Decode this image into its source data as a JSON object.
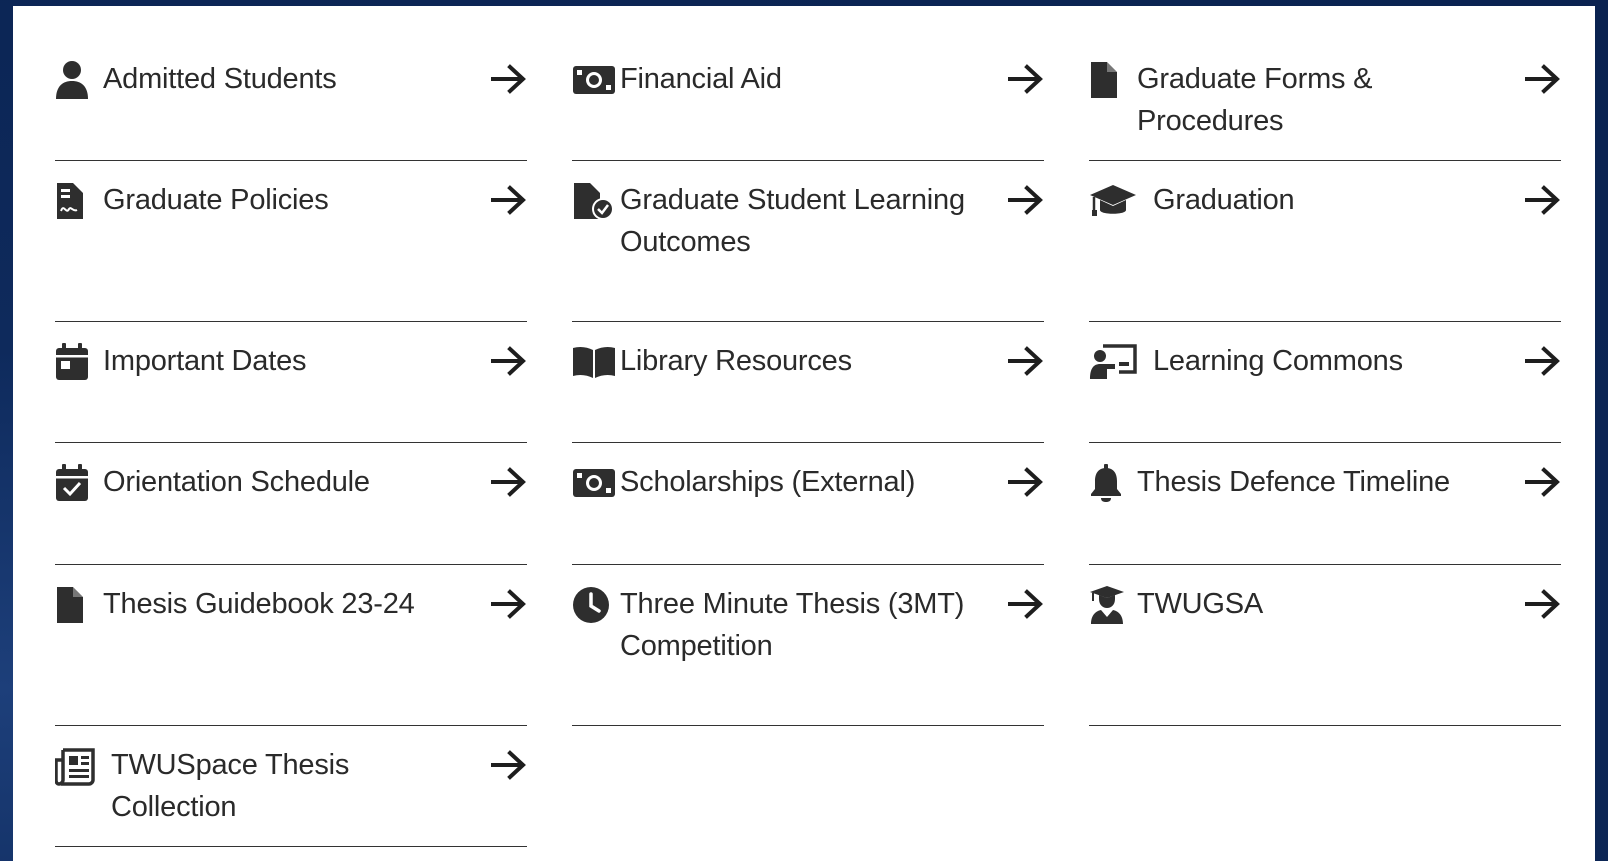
{
  "colors": {
    "background": "#0a2250",
    "panel": "#ffffff",
    "text": "#2a2a2a",
    "divider": "#333333"
  },
  "links": [
    {
      "label": "Admitted Students",
      "icon": "user-icon"
    },
    {
      "label": "Financial Aid",
      "icon": "money-bill-icon"
    },
    {
      "label": "Graduate Forms & Procedures",
      "icon": "file-icon"
    },
    {
      "label": "Graduate Policies",
      "icon": "file-signature-icon"
    },
    {
      "label": "Graduate Student Learning Outcomes",
      "icon": "file-check-icon"
    },
    {
      "label": "Graduation",
      "icon": "graduation-cap-icon"
    },
    {
      "label": "Important Dates",
      "icon": "calendar-icon"
    },
    {
      "label": "Library Resources",
      "icon": "book-open-icon"
    },
    {
      "label": "Learning Commons",
      "icon": "chalkboard-teacher-icon"
    },
    {
      "label": "Orientation Schedule",
      "icon": "calendar-check-icon"
    },
    {
      "label": "Scholarships (External)",
      "icon": "money-bill-icon"
    },
    {
      "label": "Thesis Defence Timeline",
      "icon": "bell-icon"
    },
    {
      "label": "Thesis Guidebook 23-24",
      "icon": "file-icon"
    },
    {
      "label": "Three Minute Thesis (3MT) Competition",
      "icon": "clock-icon"
    },
    {
      "label": "TWUGSA",
      "icon": "user-graduate-icon"
    },
    {
      "label": "TWUSpace Thesis Collection",
      "icon": "newspaper-icon"
    }
  ],
  "arrow_icon": "arrow-right-icon"
}
